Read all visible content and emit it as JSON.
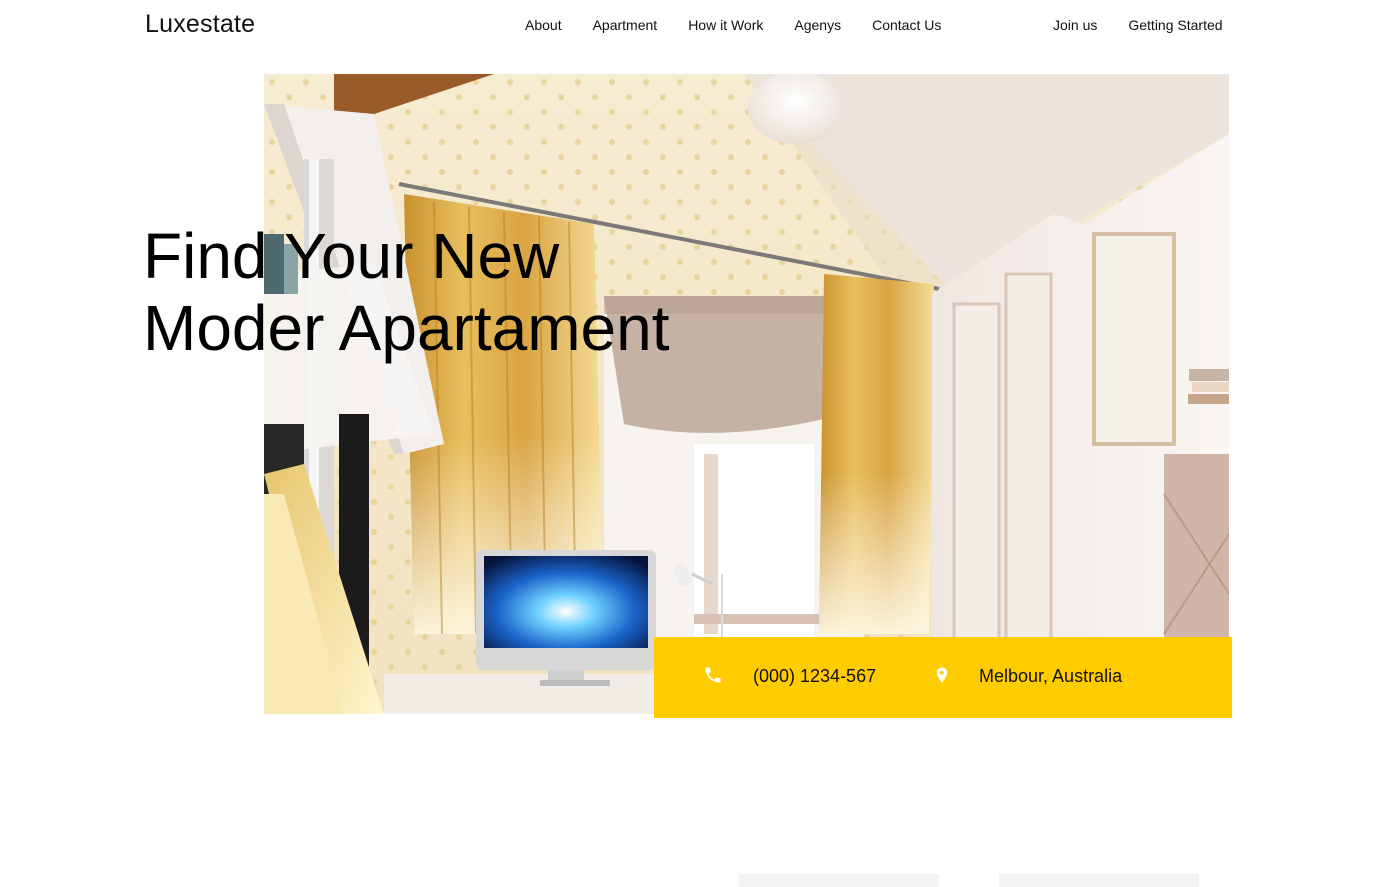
{
  "brand": {
    "name": "Luxestate"
  },
  "nav": {
    "links": [
      "About",
      "Apartment",
      "How it Work",
      "Agenys",
      "Contact Us"
    ],
    "actions": [
      "Join us",
      "Getting Started"
    ]
  },
  "hero": {
    "title_line1": "Find Your New",
    "title_line2": "Moder Apartament",
    "image_alt": "Bright attic bedroom with yellow curtains, desk and computer"
  },
  "contact": {
    "phone_icon": "phone-icon",
    "phone": "(000) 1234-567",
    "location_icon": "map-pin-icon",
    "location": "Melbour, Australia"
  },
  "colors": {
    "accent": "#ffcc00",
    "text": "#111111",
    "background": "#ffffff"
  }
}
